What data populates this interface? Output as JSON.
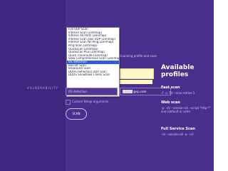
{
  "left": {
    "label": "VULNERABILITY"
  },
  "dropdown": {
    "options": [
      "Full UDP Scan",
      "Intense Scan (Zenmap)",
      "Intense All Ports (Zenmap)",
      "Intense Scan plus UDP (Zenmap)",
      "Intense Scan No Ping (Zenmap)",
      "Ping Scan (Zenmap)",
      "Quickscan (Zenmap)",
      "Quickscan Plus (Zenmap)",
      "Quick Traceroute (Zenmap)",
      "Slow Comprehensive Scan (Zenmap)",
      "OS detection",
      "Bacnet Scan",
      "Broadcast Scan",
      "DDOS Reflectors UDP Scan",
      "DDOS Snowflake Check Scan"
    ],
    "selected_index": 10
  },
  "form": {
    "hint": "Scanning profile and save",
    "profile_value": "OS detection",
    "target_value": "@sp.com",
    "checkbox_label": "Custom Nmap arguments",
    "scan_button": "SCAN"
  },
  "sidebar": {
    "title_line1": "Available",
    "title_line2": "profiles",
    "fast_title": "Fast scan",
    "fast_desc": "-F -n -T4 --max-retries 1",
    "web_title": "Web scan",
    "web_desc": "-p- -sV --version-all --script \"http-*\" and (default or safe)",
    "full_title": "Full Service Scan",
    "full_desc": "-sV --version-all -p- -sU"
  },
  "colors": {
    "background": "#4b2f8f",
    "selected_option": "#2e5fd8",
    "highlight_box": "#fff8c6"
  }
}
